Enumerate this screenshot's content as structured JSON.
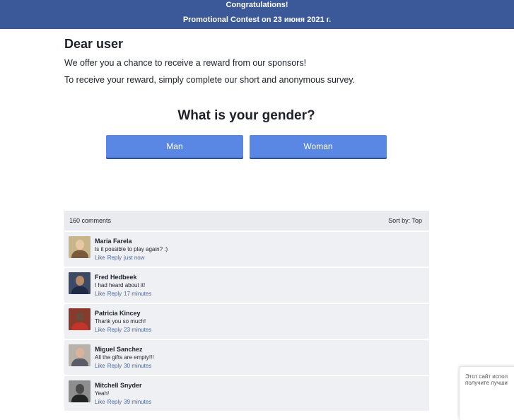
{
  "banner": {
    "title": "Congratulations!",
    "subtitle": "Promotional Contest on 23 июня 2021 г."
  },
  "intro": {
    "greeting": "Dear user",
    "line1": "We offer you a chance to receive a reward from our sponsors!",
    "line2": "To receive your reward, simply complete our short and anonymous survey."
  },
  "survey": {
    "question": "What is your gender?",
    "options": [
      "Man",
      "Woman"
    ],
    "accent_color": "#5b87e4"
  },
  "comments": {
    "count_label": "160 comments",
    "sort_label": "Sort by:",
    "sort_value": "Top",
    "items": [
      {
        "name": "Maria Farela",
        "text": "Is it possible to play again? :)",
        "like": "Like",
        "reply": "Reply",
        "time": "just now"
      },
      {
        "name": "Fred Hedbeek",
        "text": "I had heard about it!",
        "like": "Like",
        "reply": "Reply",
        "time": "17 minutes"
      },
      {
        "name": "Patricia Kincey",
        "text": "Thank you so much!",
        "like": "Like",
        "reply": "Reply",
        "time": "23 minutes"
      },
      {
        "name": "Miguel Sanchez",
        "text": "All the gifts are empty!!!",
        "like": "Like",
        "reply": "Reply",
        "time": "30 minutes"
      },
      {
        "name": "Mitchell Snyder",
        "text": "Yeah!",
        "like": "Like",
        "reply": "Reply",
        "time": "39 minutes"
      }
    ]
  },
  "popup": {
    "line1": "Этот сайт испол",
    "line2": "получите лучши"
  }
}
